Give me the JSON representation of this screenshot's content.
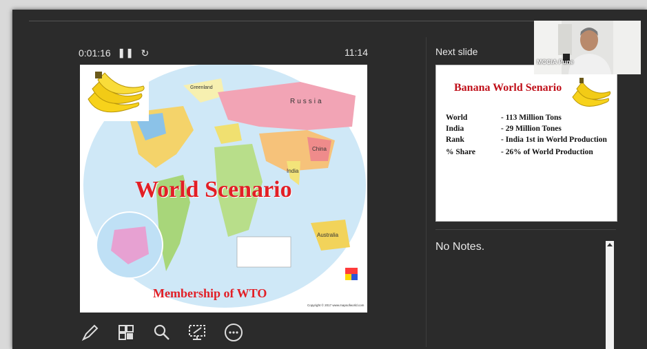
{
  "presenter": {
    "elapsed_time": "0:01:16",
    "pause_glyph": "❚❚",
    "restart_glyph": "↻",
    "clock": "11:14",
    "next_slide_label": "Next slide",
    "notes_text": "No Notes."
  },
  "current_slide": {
    "title": "World Scenario",
    "subtitle": "Membership of WTO",
    "map_labels": [
      "Russia",
      "China",
      "India",
      "Australia",
      "Greenland"
    ],
    "copyright": "Copyright © 2017 www.mapsofworld.com"
  },
  "next_slide": {
    "title": "Banana World Senario",
    "rows": [
      {
        "key": "World",
        "value": "- 113 Million Tons"
      },
      {
        "key": "India",
        "value": "- 29 Million Tones"
      },
      {
        "key": "Rank",
        "value": "- India 1st  in World Production"
      },
      {
        "key": "% Share",
        "value": "- 26% of World Production"
      }
    ]
  },
  "webcam": {
    "label": "MCCIA Pune"
  },
  "toolbar": {
    "tools": [
      "pen-tool",
      "slides-grid",
      "zoom",
      "pointer-screen",
      "more-options"
    ]
  },
  "colors": {
    "background": "#2b2b2b",
    "title_red": "#c0101a",
    "ocean": "#cfe8f7"
  }
}
